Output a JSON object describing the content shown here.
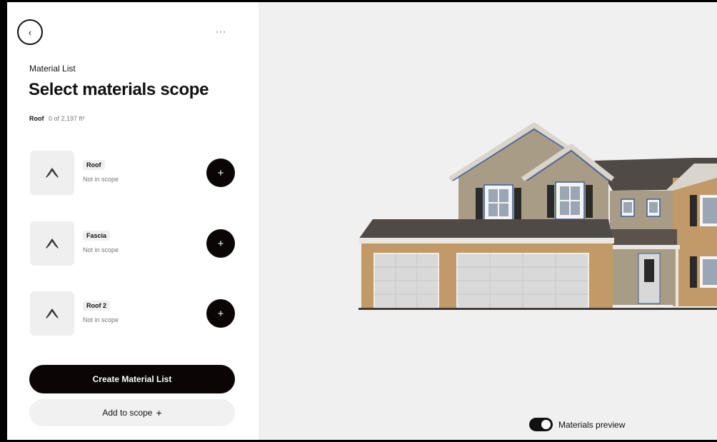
{
  "header": {
    "back_icon": "chevron-left-icon",
    "more_label": "···",
    "eyebrow": "Material List",
    "title": "Select materials scope"
  },
  "scope": {
    "label": "Roof",
    "value": "0 of 2,197 ft²"
  },
  "items": [
    {
      "name": "Roof",
      "status": "Not in scope",
      "icon": "roof-icon",
      "action": "+"
    },
    {
      "name": "Fascia",
      "status": "Not in scope",
      "icon": "roof-icon",
      "action": "+"
    },
    {
      "name": "Roof 2",
      "status": "Not in scope",
      "icon": "roof-icon",
      "action": "+"
    }
  ],
  "actions": {
    "primary": "Create Material List",
    "secondary": "Add to scope",
    "secondary_icon": "+"
  },
  "preview": {
    "toggle_label": "Materials preview",
    "toggle_on": true
  },
  "colors": {
    "accent": "#0b0505",
    "siding": "#a89c86",
    "brick": "#c29a68",
    "roof": "#4f4a46",
    "trim": "#2f5fa8"
  }
}
